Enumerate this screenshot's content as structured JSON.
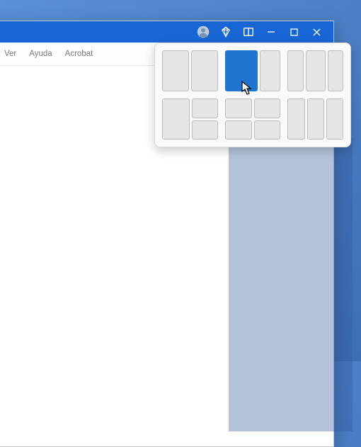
{
  "ribbon": {
    "tabs": {
      "ver": "Ver",
      "ayuda": "Ayuda",
      "acrobat": "Acrobat"
    }
  },
  "titlebar": {
    "icons": {
      "avatar": "user-avatar",
      "diamond": "diamond",
      "snap": "snap-layouts",
      "min": "minimize",
      "max": "maximize",
      "close": "close"
    }
  }
}
